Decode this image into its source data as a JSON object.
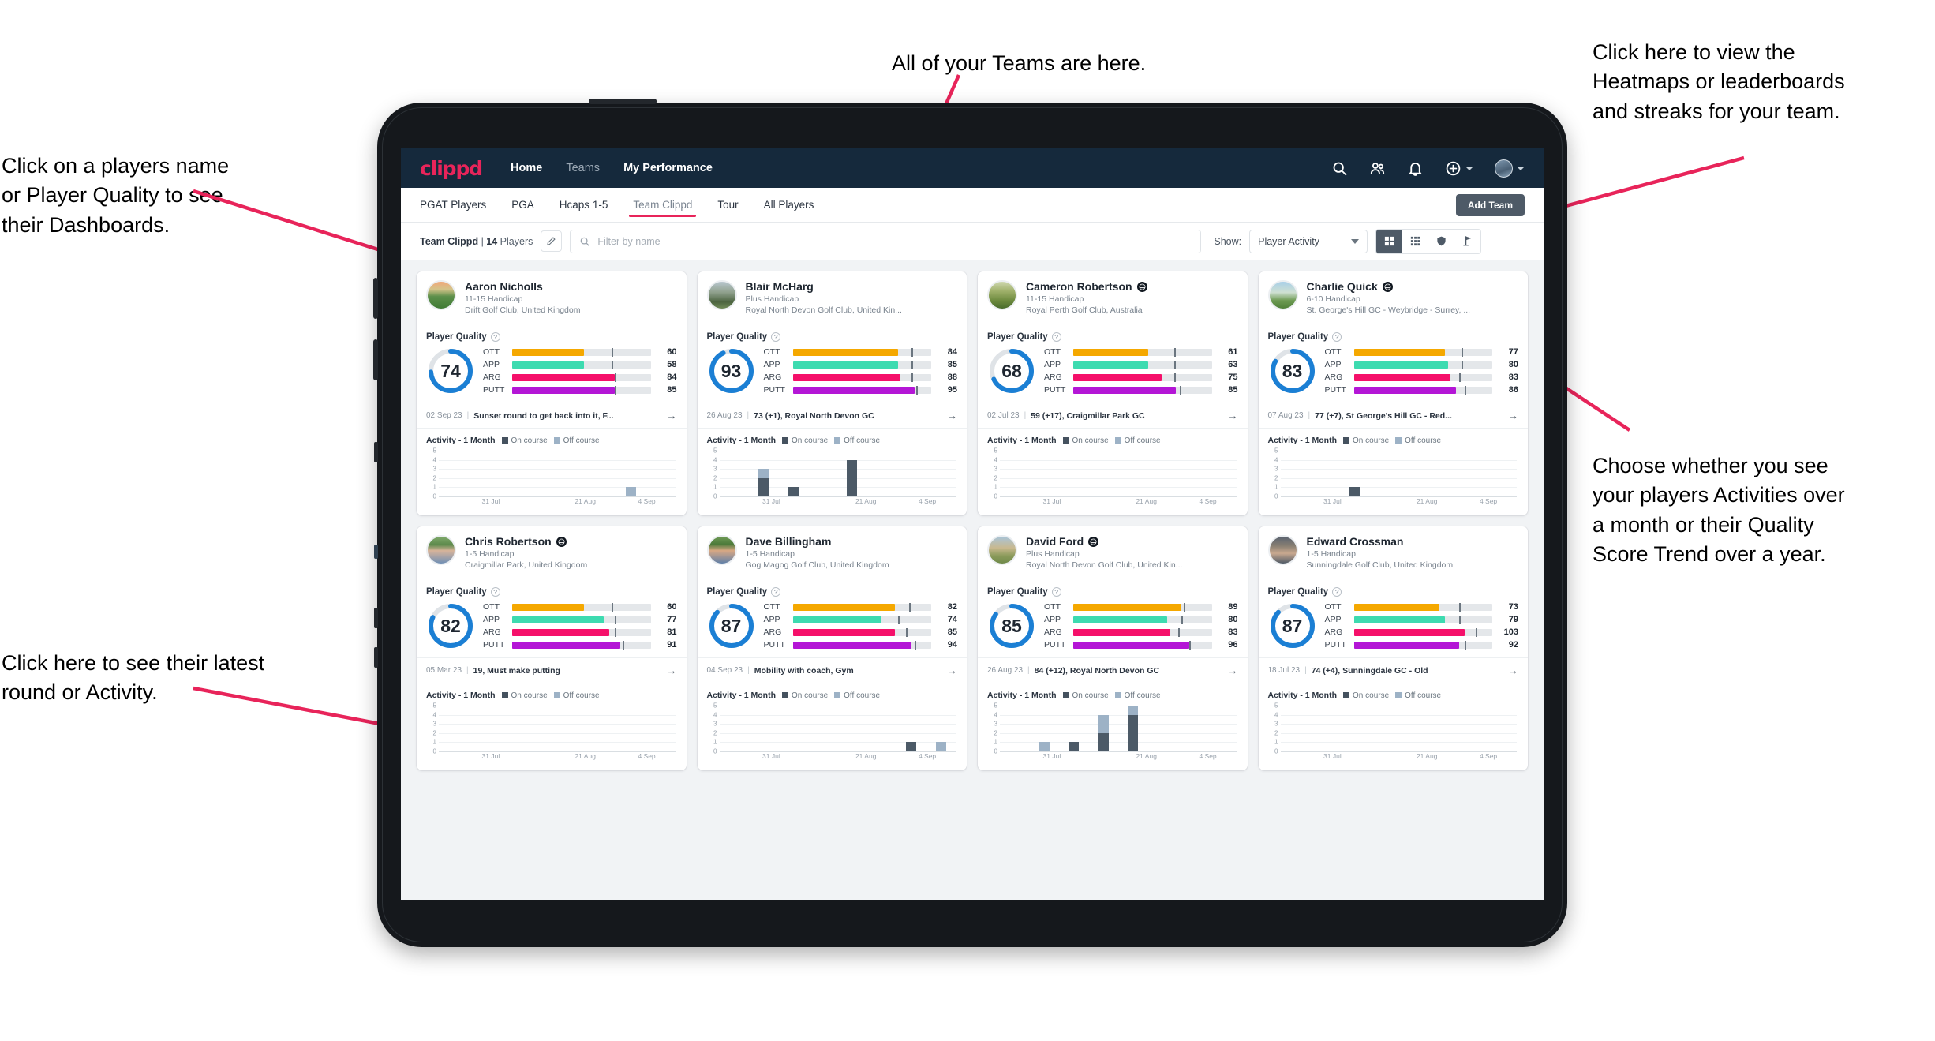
{
  "annotations": [
    {
      "id": "teams-note",
      "text": "All of your Teams are here."
    },
    {
      "id": "player-name-note",
      "text": "Click on a players name\nor Player Quality to see\ntheir Dashboards."
    },
    {
      "id": "heatmaps-note",
      "text": "Click here to view the\nHeatmaps or leaderboards\nand streaks for your team."
    },
    {
      "id": "activity-choice-note",
      "text": "Choose whether you see\nyour players Activities over\na month or their Quality\nScore Trend over a year."
    },
    {
      "id": "latest-round-note",
      "text": "Click here to see their latest\nround or Activity."
    }
  ],
  "topnav": {
    "logo": "clippd",
    "links": [
      {
        "label": "Home",
        "active": true
      },
      {
        "label": "Teams",
        "active": false
      },
      {
        "label": "My Performance",
        "active": true
      }
    ],
    "icons": [
      "search-icon",
      "people-icon",
      "bell-icon",
      "plus-circle-icon",
      "avatar"
    ]
  },
  "subnav": {
    "tabs": [
      {
        "label": "PGAT Players",
        "active": false
      },
      {
        "label": "PGA",
        "active": false
      },
      {
        "label": "Hcaps 1-5",
        "active": false
      },
      {
        "label": "Team Clippd",
        "active": true
      },
      {
        "label": "Tour",
        "active": false
      },
      {
        "label": "All Players",
        "active": false
      }
    ],
    "add_team_label": "Add Team"
  },
  "filterbar": {
    "team_name": "Team Clippd",
    "team_separator": " | ",
    "team_count": "14",
    "team_count_suffix": " Players",
    "edit_icon": "pencil-icon",
    "search_placeholder": "Filter by name",
    "search_value": "",
    "show_label": "Show:",
    "show_value": "Player Activity",
    "show_options": [
      "Player Activity",
      "Quality Score Trend"
    ],
    "view_buttons": [
      {
        "name": "grid-view",
        "icon": "grid-large-icon",
        "active": true
      },
      {
        "name": "compact-view",
        "icon": "grid-small-icon",
        "active": false
      },
      {
        "name": "heatmap-view",
        "icon": "shield-icon",
        "active": false
      },
      {
        "name": "leaderboard-view",
        "icon": "flag-icon",
        "active": false
      }
    ]
  },
  "card_labels": {
    "quality_title": "Player Quality",
    "help_glyph": "?",
    "activity_title": "Activity - 1 Month",
    "legend_on": "On course",
    "legend_off": "Off course",
    "arrow_glyph": "→",
    "separator": "|"
  },
  "chart_data": {
    "type": "bar",
    "title": "Activity - 1 Month",
    "ylabel": "",
    "xlabel": "",
    "ylim": [
      0,
      5
    ],
    "yticks": [
      0,
      1,
      2,
      3,
      4,
      5
    ],
    "xticks": [
      "31 Jul",
      "21 Aug",
      "4 Sep"
    ],
    "legend": [
      "On course",
      "Off course"
    ],
    "legend_position": "top",
    "grid": true,
    "colors": {
      "on_course": "#4c5a67",
      "off_course": "#9db2c6"
    }
  },
  "players": [
    {
      "name": "Aaron Nicholls",
      "verified": false,
      "handicap": "11-15 Handicap",
      "club": "Drift Golf Club, United Kingdom",
      "avatar_css": "linear-gradient(180deg,#f0a87a 0%,#d4c48a 28%,#5c8f4a 55%,#3f7a35 100%)",
      "quality_score": 74,
      "metrics": [
        {
          "label": "OTT",
          "value": 60,
          "fill": 52,
          "tick": 72,
          "color": "#f5a800"
        },
        {
          "label": "APP",
          "value": 58,
          "fill": 52,
          "tick": 72,
          "color": "#3ddbb0"
        },
        {
          "label": "ARG",
          "value": 84,
          "fill": 74,
          "tick": 74,
          "color": "#f5106a"
        },
        {
          "label": "PUTT",
          "value": 85,
          "fill": 74,
          "tick": 74,
          "color": "#b416d6"
        }
      ],
      "latest_date": "02 Sep 23",
      "latest_text": "Sunset round to get back into it, F...",
      "activity": [
        {
          "on": 0,
          "off": 0
        },
        {
          "on": 0,
          "off": 0
        },
        {
          "on": 0,
          "off": 0
        },
        {
          "on": 0,
          "off": 0
        },
        {
          "on": 0,
          "off": 0
        },
        {
          "on": 0,
          "off": 0
        },
        {
          "on": 0,
          "off": 1
        },
        {
          "on": 0,
          "off": 0
        }
      ]
    },
    {
      "name": "Blair McHarg",
      "verified": false,
      "handicap": "Plus Handicap",
      "club": "Royal North Devon Golf Club, United Kin...",
      "avatar_css": "linear-gradient(180deg,#b9c7cf 0%,#8fa08c 40%,#4c6440 75%,#6f8a57 100%)",
      "quality_score": 93,
      "metrics": [
        {
          "label": "OTT",
          "value": 84,
          "fill": 76,
          "tick": 86,
          "color": "#f5a800"
        },
        {
          "label": "APP",
          "value": 85,
          "fill": 76,
          "tick": 86,
          "color": "#3ddbb0"
        },
        {
          "label": "ARG",
          "value": 88,
          "fill": 78,
          "tick": 86,
          "color": "#f5106a"
        },
        {
          "label": "PUTT",
          "value": 95,
          "fill": 88,
          "tick": 89,
          "color": "#b416d6"
        }
      ],
      "latest_date": "26 Aug 23",
      "latest_text": "73 (+1), Royal North Devon GC",
      "activity": [
        {
          "on": 0,
          "off": 0
        },
        {
          "on": 2,
          "off": 1
        },
        {
          "on": 1,
          "off": 0
        },
        {
          "on": 0,
          "off": 0
        },
        {
          "on": 4,
          "off": 0
        },
        {
          "on": 0,
          "off": 0
        },
        {
          "on": 0,
          "off": 0
        },
        {
          "on": 0,
          "off": 0
        }
      ]
    },
    {
      "name": "Cameron Robertson",
      "verified": true,
      "handicap": "11-15 Handicap",
      "club": "Royal Perth Golf Club, Australia",
      "avatar_css": "linear-gradient(180deg,#cfd8b0 0%,#9fb06a 35%,#6d8a3e 70%,#486b2c 100%)",
      "quality_score": 68,
      "metrics": [
        {
          "label": "OTT",
          "value": 61,
          "fill": 54,
          "tick": 73,
          "color": "#f5a800"
        },
        {
          "label": "APP",
          "value": 63,
          "fill": 54,
          "tick": 73,
          "color": "#3ddbb0"
        },
        {
          "label": "ARG",
          "value": 75,
          "fill": 64,
          "tick": 73,
          "color": "#f5106a"
        },
        {
          "label": "PUTT",
          "value": 85,
          "fill": 74,
          "tick": 77,
          "color": "#b416d6"
        }
      ],
      "latest_date": "02 Jul 23",
      "latest_text": "59 (+17), Craigmillar Park GC",
      "activity": [
        {
          "on": 0,
          "off": 0
        },
        {
          "on": 0,
          "off": 0
        },
        {
          "on": 0,
          "off": 0
        },
        {
          "on": 0,
          "off": 0
        },
        {
          "on": 0,
          "off": 0
        },
        {
          "on": 0,
          "off": 0
        },
        {
          "on": 0,
          "off": 0
        },
        {
          "on": 0,
          "off": 0
        }
      ]
    },
    {
      "name": "Charlie Quick",
      "verified": true,
      "handicap": "6-10 Handicap",
      "club": "St. George's Hill GC - Weybridge - Surrey, ...",
      "avatar_css": "linear-gradient(180deg,#a8cfe8 0%,#cfe0d2 40%,#6d9a52 70%,#4f8038 100%)",
      "quality_score": 83,
      "metrics": [
        {
          "label": "OTT",
          "value": 77,
          "fill": 66,
          "tick": 78,
          "color": "#f5a800"
        },
        {
          "label": "APP",
          "value": 80,
          "fill": 68,
          "tick": 78,
          "color": "#3ddbb0"
        },
        {
          "label": "ARG",
          "value": 83,
          "fill": 70,
          "tick": 76,
          "color": "#f5106a"
        },
        {
          "label": "PUTT",
          "value": 86,
          "fill": 74,
          "tick": 80,
          "color": "#b416d6"
        }
      ],
      "latest_date": "07 Aug 23",
      "latest_text": "77 (+7), St George's Hill GC - Red...",
      "activity": [
        {
          "on": 0,
          "off": 0
        },
        {
          "on": 0,
          "off": 0
        },
        {
          "on": 1,
          "off": 0
        },
        {
          "on": 0,
          "off": 0
        },
        {
          "on": 0,
          "off": 0
        },
        {
          "on": 0,
          "off": 0
        },
        {
          "on": 0,
          "off": 0
        },
        {
          "on": 0,
          "off": 0
        }
      ]
    },
    {
      "name": "Chris Robertson",
      "verified": true,
      "handicap": "1-5 Handicap",
      "club": "Craigmillar Park, United Kingdom",
      "avatar_css": "linear-gradient(180deg,#7fa96a 0%,#5d8a4c 30%,#d8b49a 52%,#6f8fb5 100%)",
      "quality_score": 82,
      "metrics": [
        {
          "label": "OTT",
          "value": 60,
          "fill": 52,
          "tick": 72,
          "color": "#f5a800"
        },
        {
          "label": "APP",
          "value": 77,
          "fill": 66,
          "tick": 74,
          "color": "#3ddbb0"
        },
        {
          "label": "ARG",
          "value": 81,
          "fill": 70,
          "tick": 74,
          "color": "#f5106a"
        },
        {
          "label": "PUTT",
          "value": 91,
          "fill": 78,
          "tick": 80,
          "color": "#b416d6"
        }
      ],
      "latest_date": "05 Mar 23",
      "latest_text": "19, Must make putting",
      "activity": [
        {
          "on": 0,
          "off": 0
        },
        {
          "on": 0,
          "off": 0
        },
        {
          "on": 0,
          "off": 0
        },
        {
          "on": 0,
          "off": 0
        },
        {
          "on": 0,
          "off": 0
        },
        {
          "on": 0,
          "off": 0
        },
        {
          "on": 0,
          "off": 0
        },
        {
          "on": 0,
          "off": 0
        }
      ]
    },
    {
      "name": "Dave Billingham",
      "verified": false,
      "handicap": "1-5 Handicap",
      "club": "Gog Magog Golf Club, United Kingdom",
      "avatar_css": "linear-gradient(180deg,#6f9a55 0%,#4c7a3a 28%,#d9a884 52%,#5f7fa8 100%)",
      "quality_score": 87,
      "metrics": [
        {
          "label": "OTT",
          "value": 82,
          "fill": 74,
          "tick": 84,
          "color": "#f5a800"
        },
        {
          "label": "APP",
          "value": 74,
          "fill": 64,
          "tick": 76,
          "color": "#3ddbb0"
        },
        {
          "label": "ARG",
          "value": 85,
          "fill": 74,
          "tick": 82,
          "color": "#f5106a"
        },
        {
          "label": "PUTT",
          "value": 94,
          "fill": 86,
          "tick": 88,
          "color": "#b416d6"
        }
      ],
      "latest_date": "04 Sep 23",
      "latest_text": "Mobility with coach, Gym",
      "activity": [
        {
          "on": 0,
          "off": 0
        },
        {
          "on": 0,
          "off": 0
        },
        {
          "on": 0,
          "off": 0
        },
        {
          "on": 0,
          "off": 0
        },
        {
          "on": 0,
          "off": 0
        },
        {
          "on": 0,
          "off": 0
        },
        {
          "on": 1,
          "off": 0
        },
        {
          "on": 0,
          "off": 1
        }
      ]
    },
    {
      "name": "David Ford",
      "verified": true,
      "handicap": "Plus Handicap",
      "club": "Royal North Devon Golf Club, United Kin...",
      "avatar_css": "linear-gradient(180deg,#a9c4d8 0%,#c9b98f 42%,#8a9a5a 72%,#6f8a4a 100%)",
      "quality_score": 85,
      "metrics": [
        {
          "label": "OTT",
          "value": 89,
          "fill": 78,
          "tick": 80,
          "color": "#f5a800"
        },
        {
          "label": "APP",
          "value": 80,
          "fill": 68,
          "tick": 78,
          "color": "#3ddbb0"
        },
        {
          "label": "ARG",
          "value": 83,
          "fill": 70,
          "tick": 76,
          "color": "#f5106a"
        },
        {
          "label": "PUTT",
          "value": 96,
          "fill": 84,
          "tick": 84,
          "color": "#b416d6"
        }
      ],
      "latest_date": "26 Aug 23",
      "latest_text": "84 (+12), Royal North Devon GC",
      "activity": [
        {
          "on": 0,
          "off": 0
        },
        {
          "on": 0,
          "off": 1
        },
        {
          "on": 1,
          "off": 0
        },
        {
          "on": 2,
          "off": 2
        },
        {
          "on": 4,
          "off": 1
        },
        {
          "on": 0,
          "off": 0
        },
        {
          "on": 0,
          "off": 0
        },
        {
          "on": 0,
          "off": 0
        }
      ]
    },
    {
      "name": "Edward Crossman",
      "verified": false,
      "handicap": "1-5 Handicap",
      "club": "Sunningdale Golf Club, United Kingdom",
      "avatar_css": "linear-gradient(180deg,#5a6370 0%,#8a8073 35%,#c9a88f 62%,#4e5a66 100%)",
      "quality_score": 87,
      "metrics": [
        {
          "label": "OTT",
          "value": 73,
          "fill": 62,
          "tick": 76,
          "color": "#f5a800"
        },
        {
          "label": "APP",
          "value": 79,
          "fill": 66,
          "tick": 76,
          "color": "#3ddbb0"
        },
        {
          "label": "ARG",
          "value": 103,
          "fill": 80,
          "tick": 88,
          "color": "#f5106a"
        },
        {
          "label": "PUTT",
          "value": 92,
          "fill": 76,
          "tick": 80,
          "color": "#b416d6"
        }
      ],
      "latest_date": "18 Jul 23",
      "latest_text": "74 (+4), Sunningdale GC - Old",
      "activity": [
        {
          "on": 0,
          "off": 0
        },
        {
          "on": 0,
          "off": 0
        },
        {
          "on": 0,
          "off": 0
        },
        {
          "on": 0,
          "off": 0
        },
        {
          "on": 0,
          "off": 0
        },
        {
          "on": 0,
          "off": 0
        },
        {
          "on": 0,
          "off": 0
        },
        {
          "on": 0,
          "off": 0
        }
      ]
    }
  ]
}
